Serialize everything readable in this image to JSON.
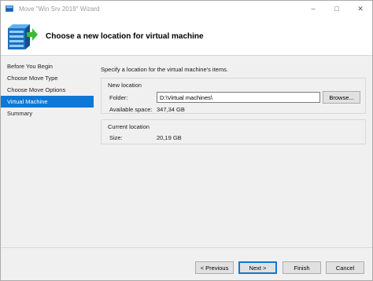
{
  "window": {
    "title": "Move \"Win Srv 2019\" Wizard"
  },
  "header": {
    "title": "Choose a new location for virtual machine"
  },
  "nav": {
    "items": [
      {
        "label": "Before You Begin"
      },
      {
        "label": "Choose Move Type"
      },
      {
        "label": "Choose Move Options"
      },
      {
        "label": "Virtual Machine",
        "active": true
      },
      {
        "label": "Summary"
      }
    ]
  },
  "content": {
    "intro": "Specify a location for the virtual machine's items.",
    "new_location": {
      "group_label": "New location",
      "folder_label": "Folder:",
      "folder_value": "D:\\Virtual machines\\",
      "browse_label": "Browse...",
      "available_label": "Available space:",
      "available_value": "347,34 GB"
    },
    "current_location": {
      "group_label": "Current location",
      "size_label": "Size:",
      "size_value": "20,19 GB"
    }
  },
  "footer": {
    "previous_label": "< Previous",
    "next_label": "Next >",
    "finish_label": "Finish",
    "cancel_label": "Cancel"
  },
  "colors": {
    "accent": "#0f78d4",
    "background": "#f0f0f0",
    "header_background": "#ffffff"
  },
  "icons": [
    "hyper-v-app-icon",
    "virtual-machine-move-icon",
    "minimize-icon",
    "maximize-icon",
    "close-icon"
  ]
}
